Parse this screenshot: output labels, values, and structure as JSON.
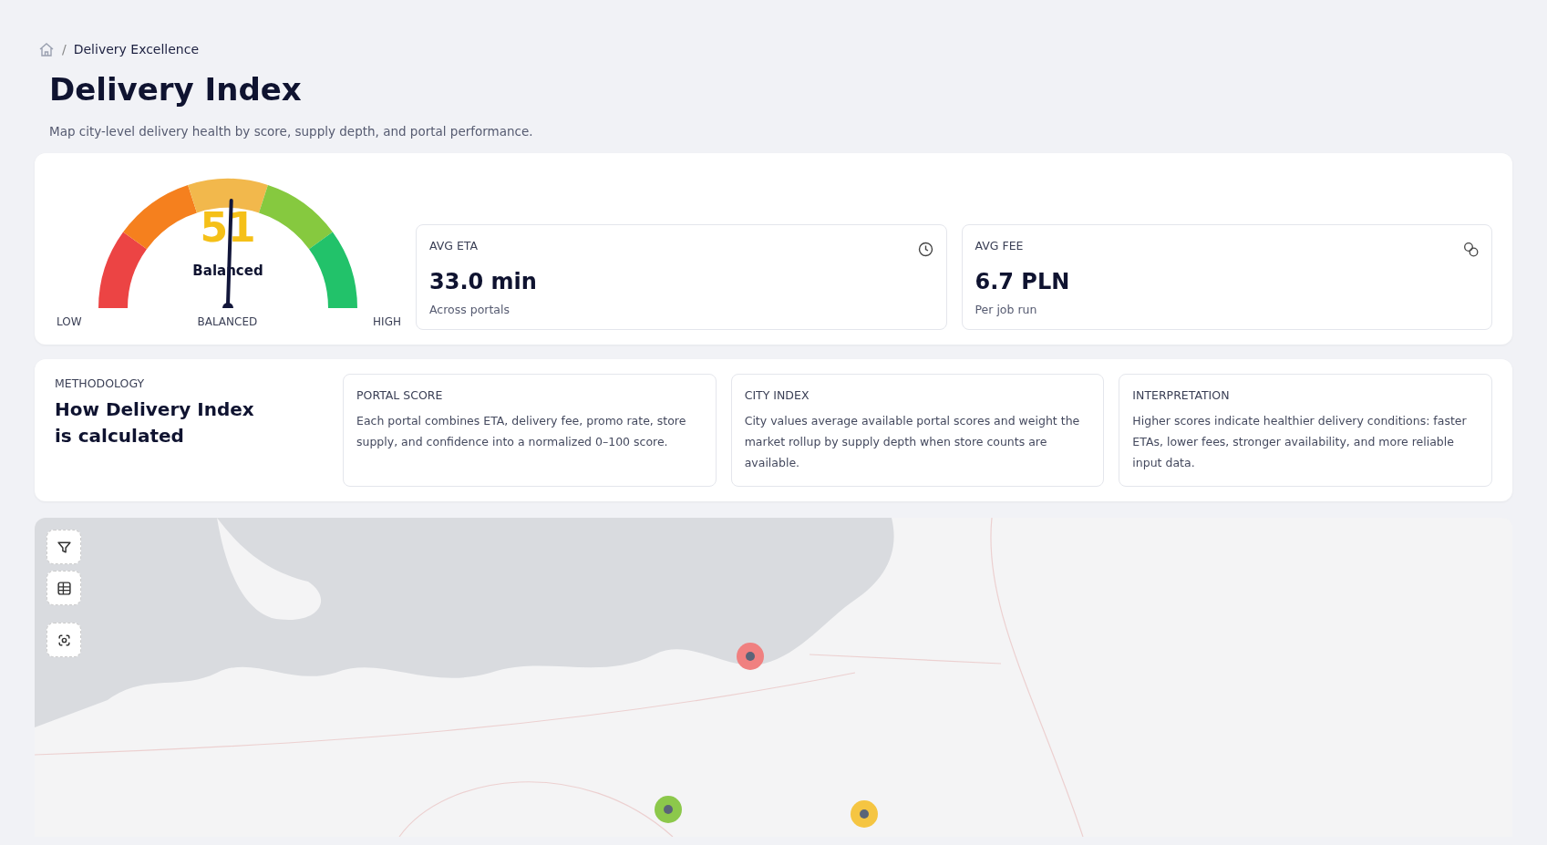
{
  "breadcrumb": {
    "separator": "/",
    "current": "Delivery Excellence"
  },
  "header": {
    "title": "Delivery Index",
    "subtitle": "Map city-level delivery health by score, supply depth, and portal performance."
  },
  "gauge": {
    "value": "51",
    "label": "Balanced",
    "level": 0.51,
    "scale_labels": [
      "LOW",
      "BALANCED",
      "HIGH"
    ]
  },
  "stats": [
    {
      "label": "AVG ETA",
      "value": "33.0 min",
      "note": "Across portals",
      "kind": "clock"
    },
    {
      "label": "AVG FEE",
      "value": "6.7 PLN",
      "note": "Per job run",
      "kind": "coins"
    }
  ],
  "methodology": {
    "eyebrow": "METHODOLOGY",
    "title": "How Delivery Index is calculated",
    "items": [
      {
        "title": "PORTAL SCORE",
        "text": "Each portal combines ETA, delivery fee, promo rate, store supply, and confidence into a normalized 0–100 score."
      },
      {
        "title": "CITY INDEX",
        "text": "City values average available portal scores and weight the market rollup by supply depth when store counts are available."
      },
      {
        "title": "INTERPRETATION",
        "text": "Higher scores indicate healthier delivery conditions: faster ETAs, lower fees, stronger availability, and more reliable input data."
      }
    ]
  },
  "map": {
    "controls": [
      {
        "kind": "filter"
      },
      {
        "kind": "table"
      },
      {
        "kind": "locate"
      }
    ],
    "markers": [
      {
        "color": "#f08080"
      },
      {
        "color": "#8cc84b"
      },
      {
        "color": "#f5c542"
      }
    ]
  }
}
